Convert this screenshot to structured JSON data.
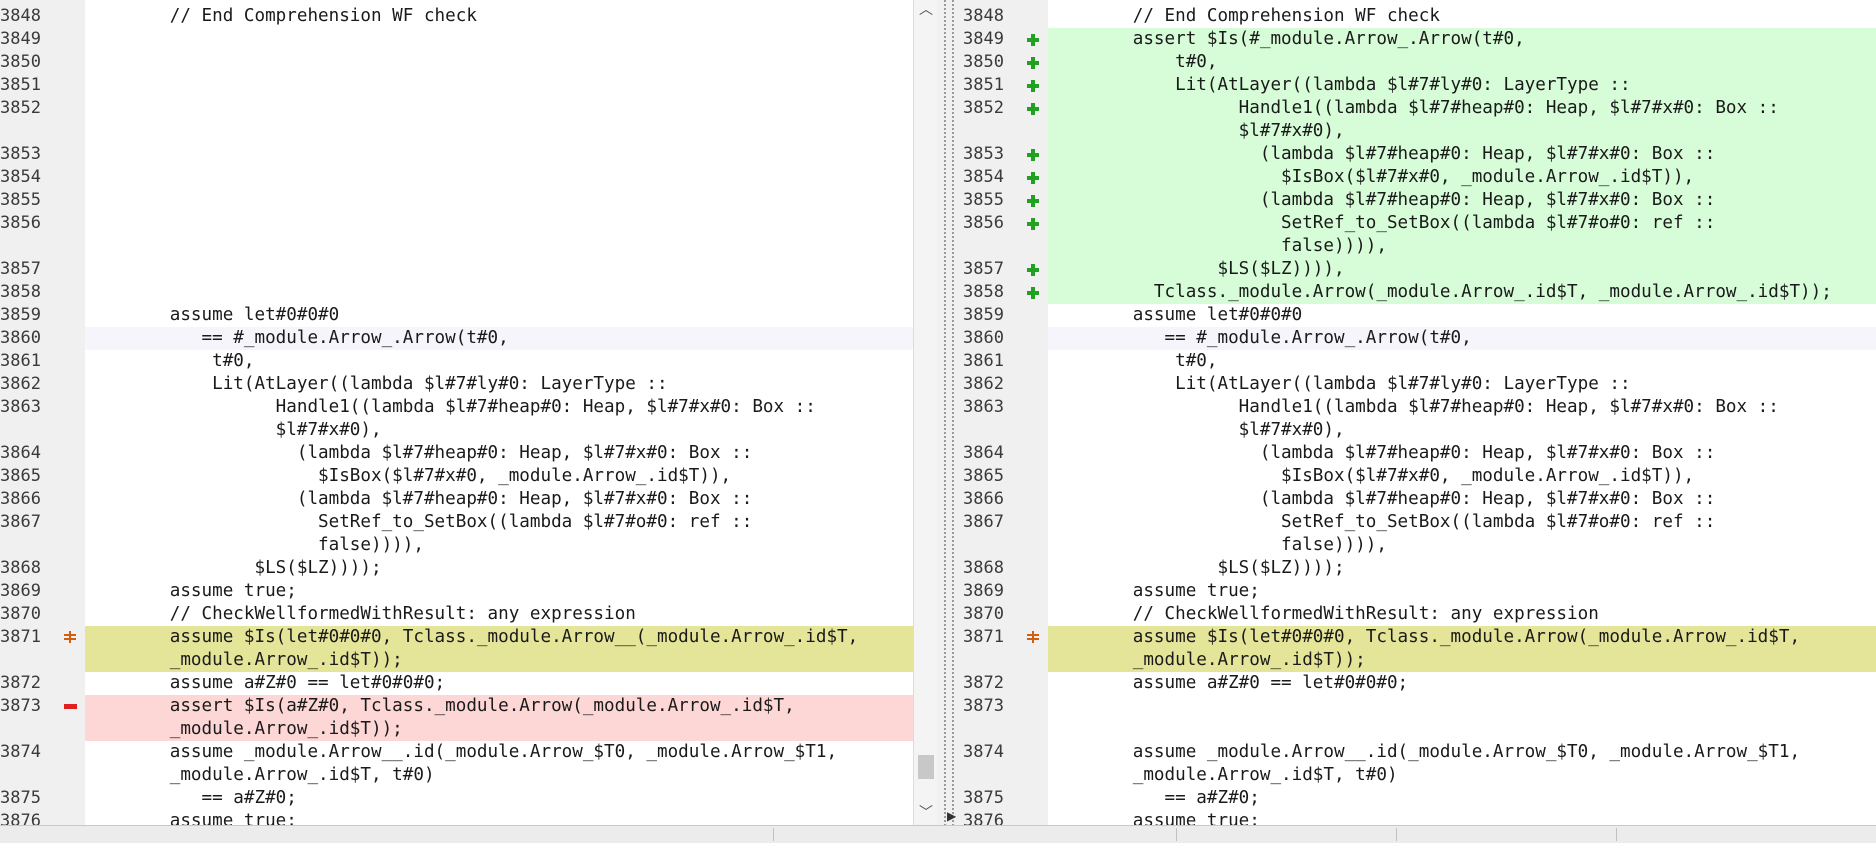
{
  "left": {
    "lines": [
      {
        "n": "3848",
        "t": "        // End Comprehension WF check",
        "bg": "",
        "m": ""
      },
      {
        "n": "3849",
        "t": "",
        "bg": "empty",
        "m": ""
      },
      {
        "n": "3850",
        "t": "",
        "bg": "empty",
        "m": ""
      },
      {
        "n": "3851",
        "t": "",
        "bg": "empty",
        "m": ""
      },
      {
        "n": "3852",
        "t": "",
        "bg": "empty",
        "m": ""
      },
      {
        "n": "",
        "t": "",
        "bg": "empty",
        "m": ""
      },
      {
        "n": "3853",
        "t": "",
        "bg": "empty",
        "m": ""
      },
      {
        "n": "3854",
        "t": "",
        "bg": "empty",
        "m": ""
      },
      {
        "n": "3855",
        "t": "",
        "bg": "empty",
        "m": ""
      },
      {
        "n": "3856",
        "t": "",
        "bg": "empty",
        "m": ""
      },
      {
        "n": "",
        "t": "",
        "bg": "empty",
        "m": ""
      },
      {
        "n": "3857",
        "t": "",
        "bg": "empty",
        "m": ""
      },
      {
        "n": "3858",
        "t": "",
        "bg": "empty",
        "m": ""
      },
      {
        "n": "3859",
        "t": "        assume let#0#0#0",
        "bg": "",
        "m": ""
      },
      {
        "n": "3860",
        "t": "           == #_module.Arrow_.Arrow(t#0,",
        "bg": "hl",
        "m": ""
      },
      {
        "n": "3861",
        "t": "            t#0,",
        "bg": "",
        "m": ""
      },
      {
        "n": "3862",
        "t": "            Lit(AtLayer((lambda $l#7#ly#0: LayerType ::",
        "bg": "",
        "m": ""
      },
      {
        "n": "3863",
        "t": "                  Handle1((lambda $l#7#heap#0: Heap, $l#7#x#0: Box ::",
        "bg": "",
        "m": ""
      },
      {
        "n": "",
        "t": "                  $l#7#x#0),",
        "bg": "",
        "m": ""
      },
      {
        "n": "3864",
        "t": "                    (lambda $l#7#heap#0: Heap, $l#7#x#0: Box ::",
        "bg": "",
        "m": ""
      },
      {
        "n": "3865",
        "t": "                      $IsBox($l#7#x#0, _module.Arrow_.id$T)),",
        "bg": "",
        "m": ""
      },
      {
        "n": "3866",
        "t": "                    (lambda $l#7#heap#0: Heap, $l#7#x#0: Box ::",
        "bg": "",
        "m": ""
      },
      {
        "n": "3867",
        "t": "                      SetRef_to_SetBox((lambda $l#7#o#0: ref ::",
        "bg": "",
        "m": ""
      },
      {
        "n": "",
        "t": "                      false)))),",
        "bg": "",
        "m": ""
      },
      {
        "n": "3868",
        "t": "                $LS($LZ))));",
        "bg": "",
        "m": ""
      },
      {
        "n": "3869",
        "t": "        assume true;",
        "bg": "",
        "m": ""
      },
      {
        "n": "3870",
        "t": "        // CheckWellformedWithResult: any expression",
        "bg": "",
        "m": ""
      },
      {
        "n": "3871",
        "t": "        assume $Is(let#0#0#0, Tclass._module.Arrow__(_module.Arrow_.id$T,",
        "bg": "change",
        "m": "change"
      },
      {
        "n": "",
        "t": "        _module.Arrow_.id$T));",
        "bg": "change",
        "m": ""
      },
      {
        "n": "3872",
        "t": "        assume a#Z#0 == let#0#0#0;",
        "bg": "",
        "m": ""
      },
      {
        "n": "3873",
        "t": "        assert $Is(a#Z#0, Tclass._module.Arrow(_module.Arrow_.id$T,",
        "bg": "delete",
        "m": "minus"
      },
      {
        "n": "",
        "t": "        _module.Arrow_.id$T));",
        "bg": "delete",
        "m": ""
      },
      {
        "n": "3874",
        "t": "        assume _module.Arrow__.id(_module.Arrow_$T0, _module.Arrow_$T1,",
        "bg": "",
        "m": ""
      },
      {
        "n": "",
        "t": "        _module.Arrow_.id$T, t#0)",
        "bg": "",
        "m": ""
      },
      {
        "n": "3875",
        "t": "           == a#Z#0;",
        "bg": "",
        "m": ""
      },
      {
        "n": "3876",
        "t": "        assume true;",
        "bg": "",
        "m": ""
      }
    ]
  },
  "right": {
    "lines": [
      {
        "n": "3848",
        "t": "        // End Comprehension WF check",
        "bg": "",
        "m": ""
      },
      {
        "n": "3849",
        "t": "        assert $Is(#_module.Arrow_.Arrow(t#0,",
        "bg": "insert",
        "m": "plus"
      },
      {
        "n": "3850",
        "t": "            t#0,",
        "bg": "insert",
        "m": "plus"
      },
      {
        "n": "3851",
        "t": "            Lit(AtLayer((lambda $l#7#ly#0: LayerType ::",
        "bg": "insert",
        "m": "plus"
      },
      {
        "n": "3852",
        "t": "                  Handle1((lambda $l#7#heap#0: Heap, $l#7#x#0: Box ::",
        "bg": "insert",
        "m": "plus"
      },
      {
        "n": "",
        "t": "                  $l#7#x#0),",
        "bg": "insert",
        "m": ""
      },
      {
        "n": "3853",
        "t": "                    (lambda $l#7#heap#0: Heap, $l#7#x#0: Box ::",
        "bg": "insert",
        "m": "plus"
      },
      {
        "n": "3854",
        "t": "                      $IsBox($l#7#x#0, _module.Arrow_.id$T)),",
        "bg": "insert",
        "m": "plus"
      },
      {
        "n": "3855",
        "t": "                    (lambda $l#7#heap#0: Heap, $l#7#x#0: Box ::",
        "bg": "insert",
        "m": "plus"
      },
      {
        "n": "3856",
        "t": "                      SetRef_to_SetBox((lambda $l#7#o#0: ref ::",
        "bg": "insert",
        "m": "plus"
      },
      {
        "n": "",
        "t": "                      false)))),",
        "bg": "insert",
        "m": ""
      },
      {
        "n": "3857",
        "t": "                $LS($LZ)))),",
        "bg": "insert",
        "m": "plus"
      },
      {
        "n": "3858",
        "t": "          Tclass._module.Arrow(_module.Arrow_.id$T, _module.Arrow_.id$T));",
        "bg": "insert",
        "m": "plus"
      },
      {
        "n": "3859",
        "t": "        assume let#0#0#0",
        "bg": "",
        "m": ""
      },
      {
        "n": "3860",
        "t": "           == #_module.Arrow_.Arrow(t#0,",
        "bg": "hl",
        "m": ""
      },
      {
        "n": "3861",
        "t": "            t#0,",
        "bg": "",
        "m": ""
      },
      {
        "n": "3862",
        "t": "            Lit(AtLayer((lambda $l#7#ly#0: LayerType ::",
        "bg": "",
        "m": ""
      },
      {
        "n": "3863",
        "t": "                  Handle1((lambda $l#7#heap#0: Heap, $l#7#x#0: Box ::",
        "bg": "",
        "m": ""
      },
      {
        "n": "",
        "t": "                  $l#7#x#0),",
        "bg": "",
        "m": ""
      },
      {
        "n": "3864",
        "t": "                    (lambda $l#7#heap#0: Heap, $l#7#x#0: Box ::",
        "bg": "",
        "m": ""
      },
      {
        "n": "3865",
        "t": "                      $IsBox($l#7#x#0, _module.Arrow_.id$T)),",
        "bg": "",
        "m": ""
      },
      {
        "n": "3866",
        "t": "                    (lambda $l#7#heap#0: Heap, $l#7#x#0: Box ::",
        "bg": "",
        "m": ""
      },
      {
        "n": "3867",
        "t": "                      SetRef_to_SetBox((lambda $l#7#o#0: ref ::",
        "bg": "",
        "m": ""
      },
      {
        "n": "",
        "t": "                      false)))),",
        "bg": "",
        "m": ""
      },
      {
        "n": "3868",
        "t": "                $LS($LZ))));",
        "bg": "",
        "m": ""
      },
      {
        "n": "3869",
        "t": "        assume true;",
        "bg": "",
        "m": ""
      },
      {
        "n": "3870",
        "t": "        // CheckWellformedWithResult: any expression",
        "bg": "",
        "m": ""
      },
      {
        "n": "3871",
        "t": "        assume $Is(let#0#0#0, Tclass._module.Arrow(_module.Arrow_.id$T,",
        "bg": "change",
        "m": "change"
      },
      {
        "n": "",
        "t": "        _module.Arrow_.id$T));",
        "bg": "change",
        "m": ""
      },
      {
        "n": "3872",
        "t": "        assume a#Z#0 == let#0#0#0;",
        "bg": "",
        "m": ""
      },
      {
        "n": "3873",
        "t": "",
        "bg": "empty",
        "m": ""
      },
      {
        "n": "",
        "t": "",
        "bg": "empty",
        "m": ""
      },
      {
        "n": "3874",
        "t": "        assume _module.Arrow__.id(_module.Arrow_$T0, _module.Arrow_$T1,",
        "bg": "",
        "m": ""
      },
      {
        "n": "",
        "t": "        _module.Arrow_.id$T, t#0)",
        "bg": "",
        "m": ""
      },
      {
        "n": "3875",
        "t": "           == a#Z#0;",
        "bg": "",
        "m": ""
      },
      {
        "n": "3876",
        "t": "        assume true;",
        "bg": "",
        "m": ""
      }
    ]
  },
  "colors": {
    "insert_bg": "#d7fcd8",
    "delete_bg": "#fdd6d6",
    "change_bg": "#e5e59a",
    "empty_bg": "#dcdcdc",
    "gutter_bg": "#f0f0f0"
  },
  "icons": {
    "insert": "plus-icon",
    "delete": "minus-icon",
    "change": "change-icon",
    "scroll_up": "chevron-up-icon",
    "scroll_down": "chevron-down-icon"
  }
}
